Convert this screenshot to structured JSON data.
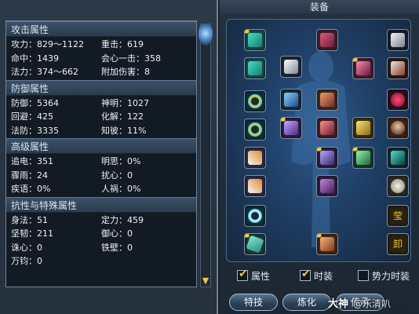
{
  "stats": {
    "sections": [
      {
        "title": "攻击属性",
        "rows": [
          [
            "攻力：829～1122",
            "重击：619"
          ],
          [
            "命中：1439",
            "会心一击：358"
          ],
          [
            "法力：374～662",
            "附加伤害：8"
          ]
        ]
      },
      {
        "title": "防御属性",
        "rows": [
          [
            "防御：5364",
            "神明：1027"
          ],
          [
            "回避：425",
            "化解：122"
          ],
          [
            "法防：3335",
            "知彼：11%"
          ]
        ]
      },
      {
        "title": "高级属性",
        "rows": [
          [
            "追电：351",
            "明思：0%"
          ],
          [
            "骤雨：24",
            "扰心：0"
          ],
          [
            "疾语：0%",
            "人祸：0%"
          ]
        ]
      },
      {
        "title": "抗性与特殊属性",
        "rows": [
          [
            "身法：51",
            "定力：459"
          ],
          [
            "坚韧：211",
            "御心：0"
          ],
          [
            "诛心：0",
            "铁壁：0"
          ],
          [
            "万钧：0",
            ""
          ]
        ]
      }
    ]
  },
  "equipment": {
    "title": "装备",
    "checkboxes": [
      {
        "label": "属性",
        "checked": true
      },
      {
        "label": "时装",
        "checked": true
      },
      {
        "label": "势力时装",
        "checked": false
      }
    ],
    "buttons": [
      "特技",
      "炼化",
      "传承"
    ],
    "watermark": "大神",
    "watermark_sub": "@乐清叭",
    "slot_unload_label": "卸",
    "slot_fashion_label": "莹"
  },
  "colors": {
    "accent_gold": "#f0c42b",
    "panel_blue": "#1f3f66"
  }
}
